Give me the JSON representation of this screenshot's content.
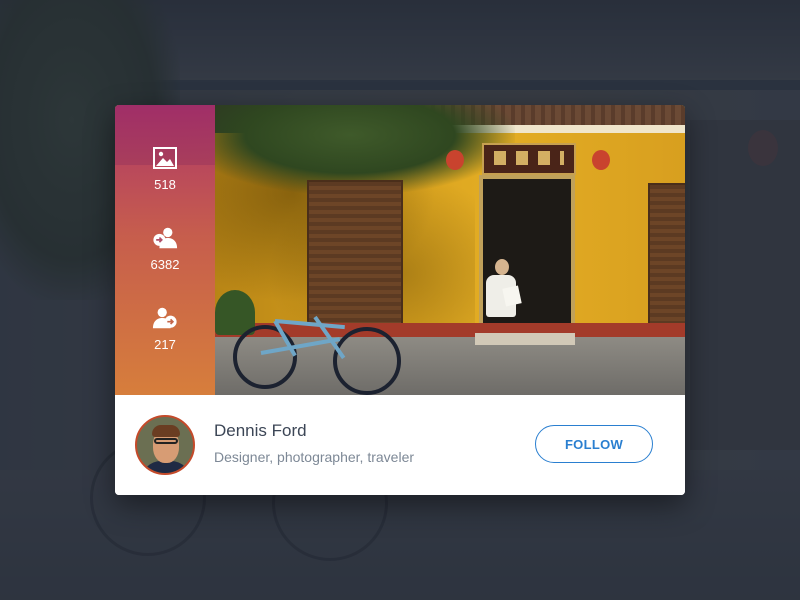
{
  "profile_card": {
    "name": "Dennis Ford",
    "bio": "Designer, photographer, traveler",
    "follow_label": "FOLLOW",
    "stats": [
      {
        "icon": "image-icon",
        "value": "518"
      },
      {
        "icon": "followers-icon",
        "value": "6382"
      },
      {
        "icon": "following-icon",
        "value": "217"
      }
    ]
  },
  "colors": {
    "accent": "#2a7fd0",
    "overlay_top": "#aa2d6e",
    "overlay_bottom": "#d6783f",
    "name_text": "#3c4656",
    "bio_text": "#7d8896"
  }
}
